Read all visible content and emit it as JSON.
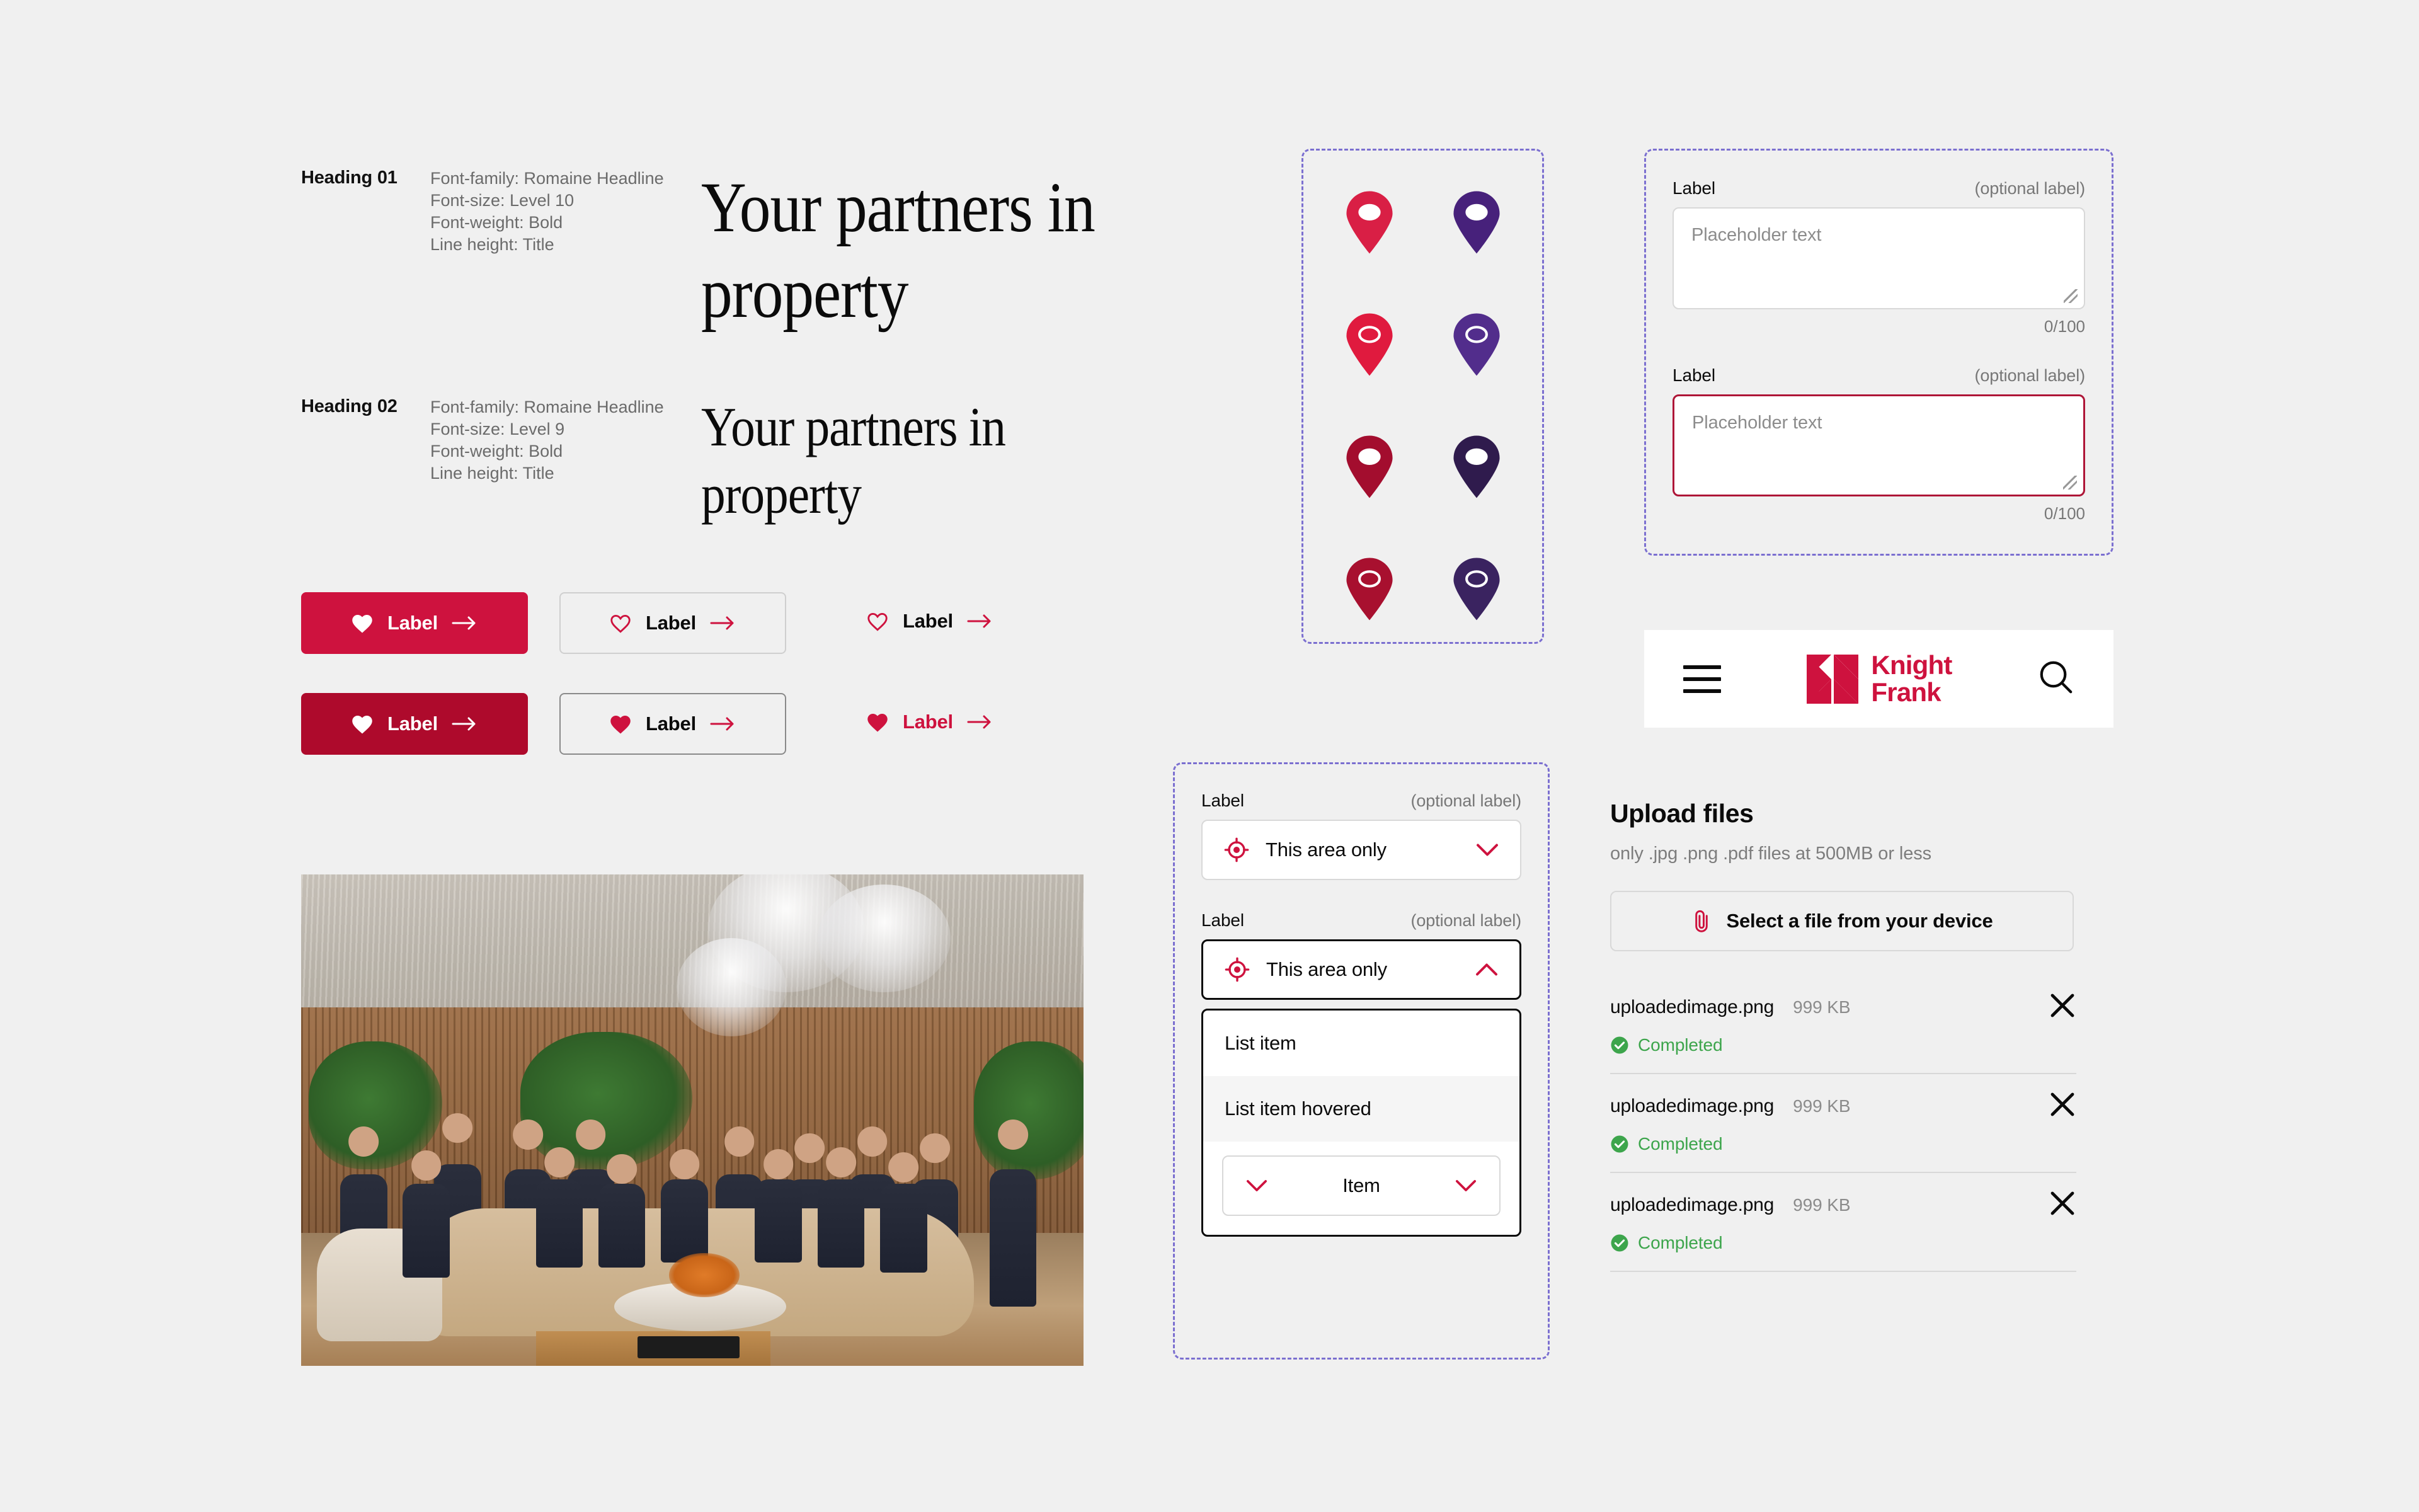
{
  "typography": {
    "rows": [
      {
        "name": "Heading 01",
        "specs": "Font-family: Romaine Headline\nFont-size: Level 10\nFont-weight: Bold\nLine height: Title",
        "sample": "Your partners in property"
      },
      {
        "name": "Heading 02",
        "specs": "Font-family: Romaine Headline\nFont-size: Level 9\nFont-weight: Bold\nLine height: Title",
        "sample": "Your partners in property"
      }
    ]
  },
  "buttons": {
    "primary_default": {
      "label": "Label",
      "heart": "heart-filled",
      "arrow": "arrow-right"
    },
    "primary_hover": {
      "label": "Label",
      "heart": "heart-filled",
      "arrow": "arrow-right"
    },
    "secondary_default": {
      "label": "Label",
      "heart": "heart-outline",
      "arrow": "arrow-right"
    },
    "secondary_hover": {
      "label": "Label",
      "heart": "heart-filled",
      "arrow": "arrow-right"
    },
    "text_default": {
      "label": "Label",
      "heart": "heart-outline",
      "arrow": "arrow-right"
    },
    "text_hover": {
      "label": "Label",
      "heart": "heart-filled",
      "arrow": "arrow-right"
    }
  },
  "pins": [
    {
      "color": "#D91F45",
      "marker": "dot"
    },
    {
      "color": "#47217B",
      "marker": "dot"
    },
    {
      "color": "#E01A3E",
      "marker": "ring"
    },
    {
      "color": "#522D8C",
      "marker": "ring"
    },
    {
      "color": "#A30D2E",
      "marker": "dot"
    },
    {
      "color": "#2F1B4D",
      "marker": "dot"
    },
    {
      "color": "#A8102F",
      "marker": "ring"
    },
    {
      "color": "#3A2360",
      "marker": "ring"
    }
  ],
  "textarea_panel": {
    "fields": [
      {
        "label": "Label",
        "optional": "(optional label)",
        "placeholder": "Placeholder text",
        "counter": "0/100",
        "state": "default"
      },
      {
        "label": "Label",
        "optional": "(optional label)",
        "placeholder": "Placeholder text",
        "counter": "0/100",
        "state": "focused"
      }
    ]
  },
  "select_panel": {
    "fields": [
      {
        "label": "Label",
        "optional": "(optional label)",
        "value": "This area only",
        "chevron": "chevron-down",
        "state": "closed"
      },
      {
        "label": "Label",
        "optional": "(optional label)",
        "value": "This area only",
        "chevron": "chevron-up",
        "state": "open"
      }
    ],
    "list_items": [
      {
        "label": "List item",
        "state": "default"
      },
      {
        "label": "List item hovered",
        "state": "hovered"
      }
    ],
    "footer_item": {
      "label": "Item",
      "left_chevron": "chevron-down",
      "right_chevron": "chevron-down"
    }
  },
  "header": {
    "menu_icon": "hamburger-icon",
    "logo_line1": "Knight",
    "logo_line2": "Frank",
    "search_icon": "search-icon"
  },
  "upload": {
    "title": "Upload files",
    "subtitle": "only .jpg .png .pdf files at 500MB or less",
    "button_label": "Select a file from your device",
    "button_icon": "paperclip-icon",
    "files": [
      {
        "name": "uploadedimage.png",
        "size": "999 KB",
        "status": "Completed",
        "remove_icon": "close-icon"
      },
      {
        "name": "uploadedimage.png",
        "size": "999 KB",
        "status": "Completed",
        "remove_icon": "close-icon"
      },
      {
        "name": "uploadedimage.png",
        "size": "999 KB",
        "status": "Completed",
        "remove_icon": "close-icon"
      }
    ]
  },
  "photo": {
    "alt": "Knight Frank team group photo in a luxury lounge"
  },
  "colors": {
    "brand_crimson": "#CE123E",
    "brand_crimson_dark": "#AE0A2C",
    "purple": "#47217B",
    "purple_dark": "#2F1B4D",
    "dashed_guide": "#7B6FD0",
    "success_green": "#3DA54C",
    "page_bg": "#F0F0F0"
  }
}
